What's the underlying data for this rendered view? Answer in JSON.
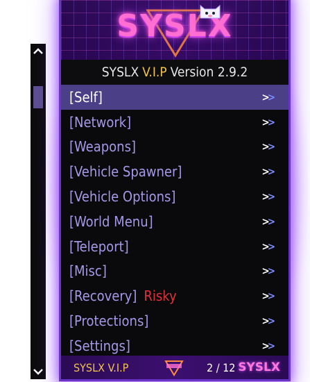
{
  "header": {
    "logo_text": "SYSLX",
    "title_prefix": "SYSLX",
    "title_vip": "V.I.P",
    "title_suffix": "Version 2.9.2"
  },
  "menu": {
    "items": [
      {
        "label": "[Self]",
        "chevron": ">>",
        "selected": true
      },
      {
        "label": "[Network]",
        "chevron": ">>"
      },
      {
        "label": "[Weapons]",
        "chevron": ">>"
      },
      {
        "label": "[Vehicle Spawner]",
        "chevron": ">>"
      },
      {
        "label": "[Vehicle Options]",
        "chevron": ">>"
      },
      {
        "label": "[World Menu]",
        "chevron": ">>"
      },
      {
        "label": "[Teleport]",
        "chevron": ">>"
      },
      {
        "label": "[Misc]",
        "chevron": ">>"
      },
      {
        "label": "[Recovery]",
        "tag": "Risky",
        "chevron": ">>"
      },
      {
        "label": "[Protections]",
        "chevron": ">>"
      },
      {
        "label": "[Settings]",
        "chevron": ">>"
      }
    ]
  },
  "footer": {
    "left_text": "SYSLX V.I.P",
    "page_indicator": "2 / 12",
    "right_logo": "SYSLX"
  },
  "scrollbar": {
    "up_icon": "chevron-up-icon",
    "down_icon": "chevron-down-icon"
  },
  "colors": {
    "accent_purple": "#6a34c8",
    "selected_row": "#4b3f88",
    "item_text": "#a698e8",
    "vip_gold": "#f4c542",
    "risky_red": "#e0303a",
    "logo_pink": "#ff6fd2"
  }
}
